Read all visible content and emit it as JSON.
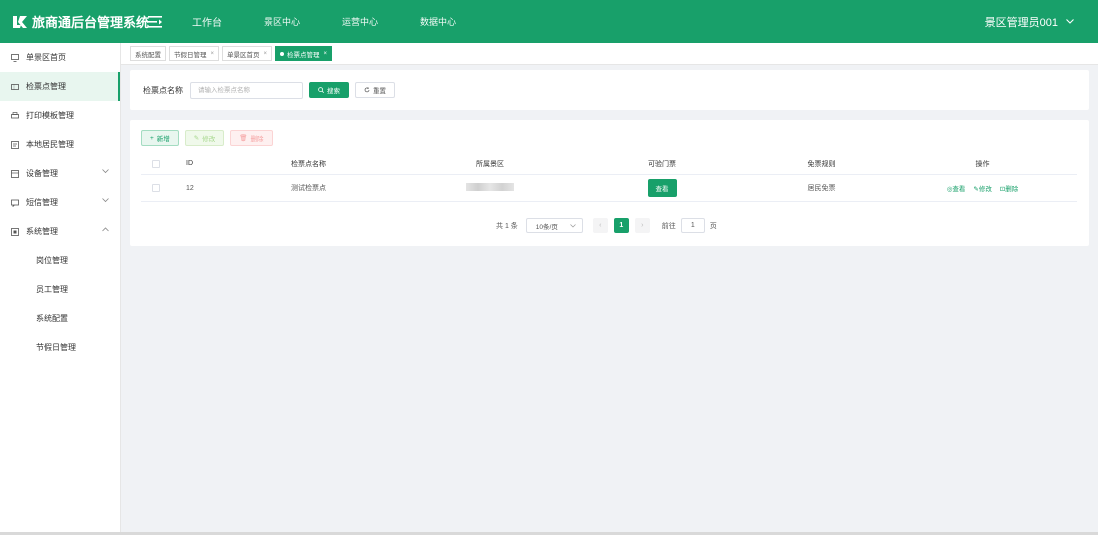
{
  "header": {
    "app_title": "旅商通后台管理系统",
    "nav": [
      "工作台",
      "景区中心",
      "运营中心",
      "数据中心"
    ],
    "user": "景区管理员001",
    "accent": "#18a06a"
  },
  "sidebar": {
    "items": [
      {
        "label": "单景区首页",
        "icon": "monitor-icon"
      },
      {
        "label": "检票点管理",
        "icon": "ticket-icon",
        "active": true
      },
      {
        "label": "打印模板管理",
        "icon": "printer-icon"
      },
      {
        "label": "本地居民管理",
        "icon": "id-card-icon"
      },
      {
        "label": "设备管理",
        "icon": "device-icon",
        "expandable": true
      },
      {
        "label": "短信管理",
        "icon": "message-icon",
        "expandable": true
      },
      {
        "label": "系统管理",
        "icon": "settings-icon",
        "expanded": true
      }
    ],
    "sub_items": [
      "岗位管理",
      "员工管理",
      "系统配置",
      "节假日管理"
    ]
  },
  "tabs": [
    {
      "label": "系统配置"
    },
    {
      "label": "节假日管理"
    },
    {
      "label": "单景区首页"
    },
    {
      "label": "检票点管理",
      "active": true
    }
  ],
  "search": {
    "label": "检票点名称",
    "placeholder": "请输入检票点名称",
    "search_btn": "搜索",
    "reset_btn": "重置"
  },
  "toolbar": {
    "add": "新增",
    "edit": "修改",
    "delete": "删除"
  },
  "table": {
    "columns": [
      "ID",
      "检票点名称",
      "所属景区",
      "可验门票",
      "免票规则",
      "操作"
    ],
    "rows": [
      {
        "id": "12",
        "name": "测试检票点",
        "scene": "",
        "door_btn": "查看",
        "rule": "居民免票"
      }
    ],
    "actions": [
      "查看",
      "修改",
      "删除"
    ]
  },
  "pagination": {
    "total": "共 1 条",
    "page_size": "10条/页",
    "current": "1",
    "goto_label": "前往",
    "goto_value": "1",
    "page_suffix": "页"
  }
}
